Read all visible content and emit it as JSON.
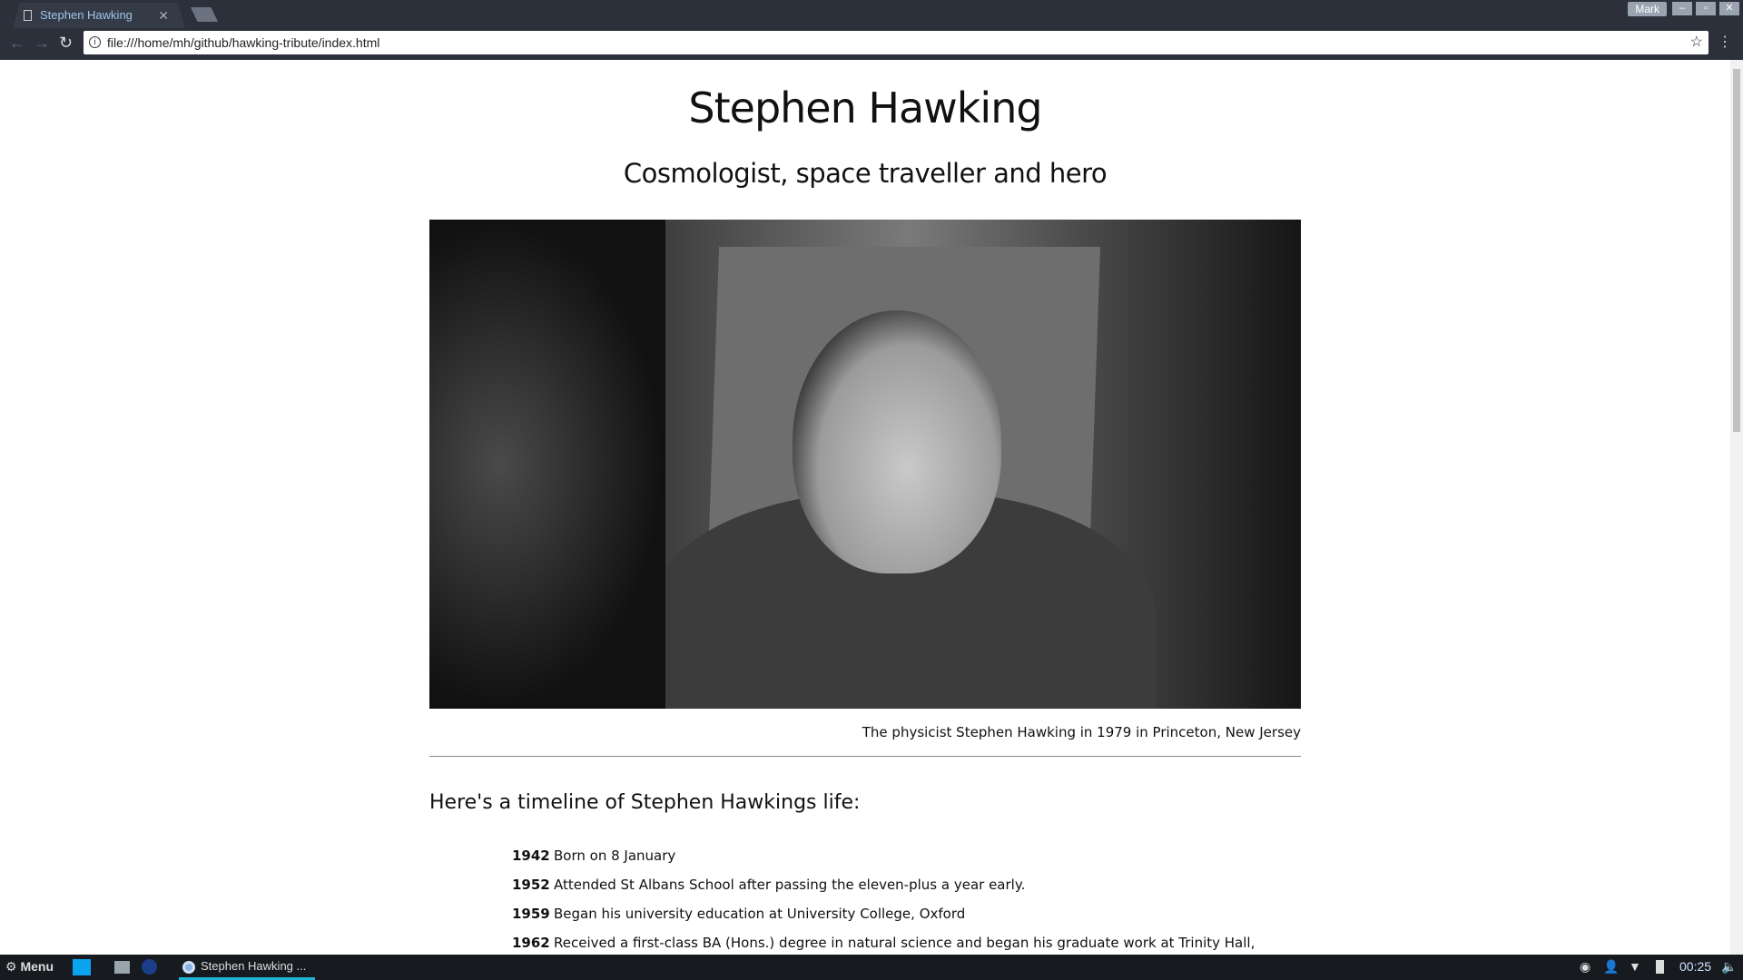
{
  "browser": {
    "tab_title": "Stephen Hawking",
    "url": "file:///home/mh/github/hawking-tribute/index.html",
    "user": "Mark"
  },
  "page": {
    "title": "Stephen Hawking",
    "subtitle": "Cosmologist, space traveller and hero",
    "caption": "The physicist Stephen Hawking in 1979 in Princeton, New Jersey",
    "timeline_heading": "Here's a timeline of Stephen Hawkings life:",
    "timeline": [
      {
        "year": "1942",
        "text": "Born on 8 January"
      },
      {
        "year": "1952",
        "text": "Attended St Albans School after passing the eleven-plus a year early."
      },
      {
        "year": "1959",
        "text": "Began his university education at University College, Oxford"
      },
      {
        "year": "1962",
        "text": "Received a first-class BA (Hons.) degree in natural science and began his graduate work at Trinity Hall,"
      }
    ]
  },
  "taskbar": {
    "menu": "Menu",
    "app": "Stephen Hawking ...",
    "clock": "00:25"
  }
}
